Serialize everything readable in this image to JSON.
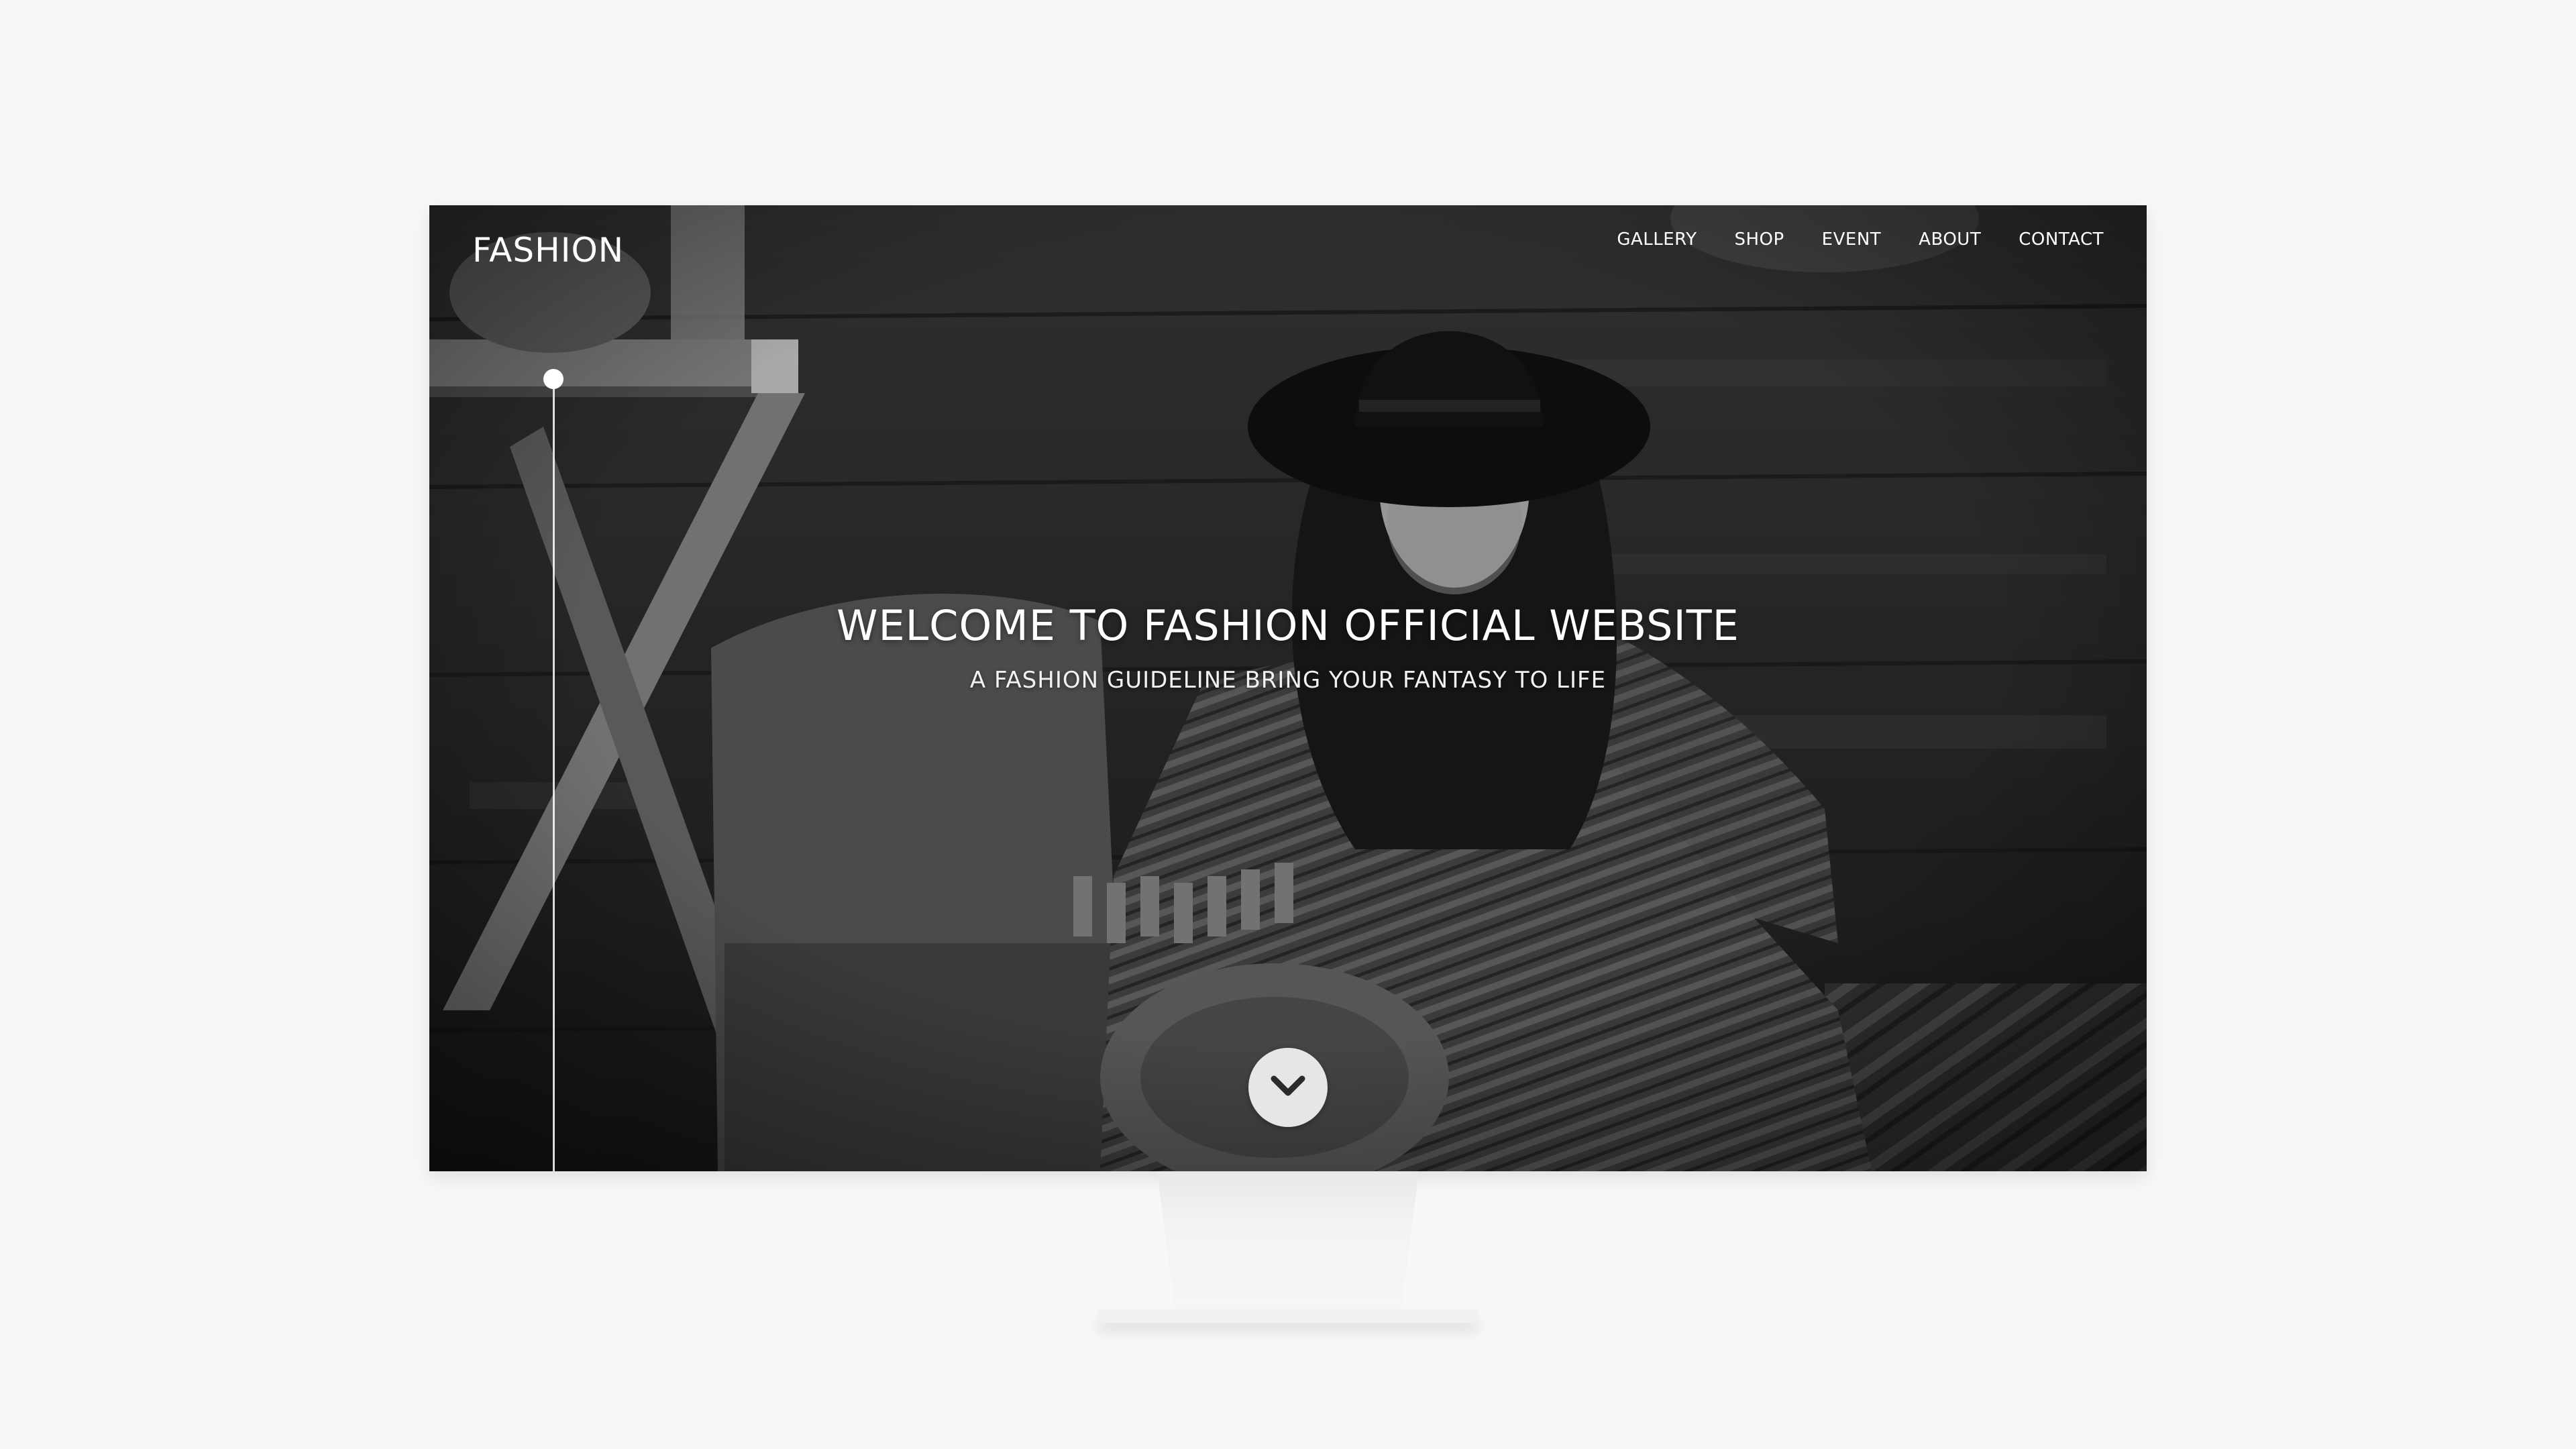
{
  "header": {
    "logo": "FASHION",
    "nav": [
      "GALLERY",
      "SHOP",
      "EVENT",
      "ABOUT",
      "CONTACT"
    ]
  },
  "hero": {
    "title": "WELCOME TO FASHION OFFICIAL WEBSITE",
    "subtitle": "A FASHION GUIDELINE BRING YOUR FANTASY TO LIFE"
  },
  "icons": {
    "scroll_down": "chevron-down-icon",
    "scroll_indicator": "scroll-progress-dot"
  },
  "colors": {
    "page_background": "#f8f8f8",
    "nav_text": "#ffffff",
    "button_background": "#e6e6e6"
  }
}
